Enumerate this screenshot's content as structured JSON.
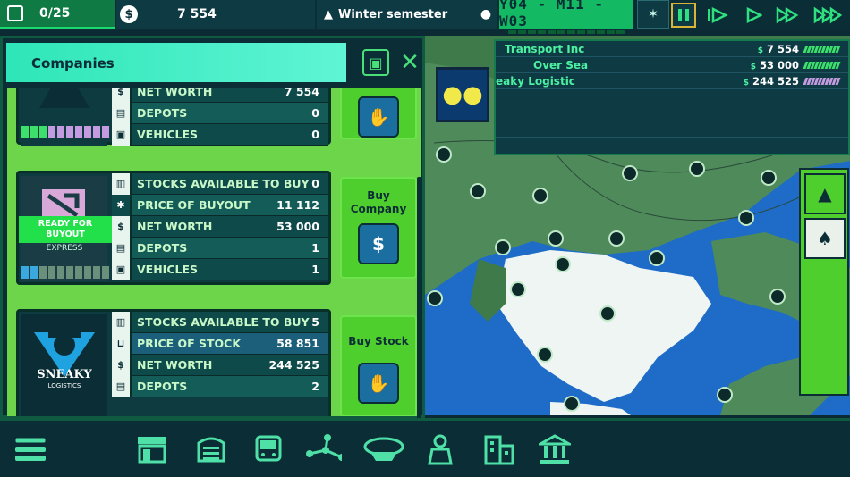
{
  "topbar": {
    "vehicles": "0/25",
    "money": "7 554",
    "semester": "Winter semester",
    "date": "Y04 - M11 - W03"
  },
  "panel": {
    "title": "Companies"
  },
  "cards": [
    {
      "rows": [
        {
          "label": "NET WORTH",
          "value": "7 554"
        },
        {
          "label": "DEPOTS",
          "value": "0"
        },
        {
          "label": "VEHICLES",
          "value": "0"
        }
      ]
    },
    {
      "badge": "READY FOR BUYOUT",
      "logo_text": "EXPRESS",
      "action": "Buy Company",
      "rows": [
        {
          "label": "STOCKS AVAILABLE TO BUY",
          "value": "0"
        },
        {
          "label": "PRICE OF BUYOUT",
          "value": "11 112"
        },
        {
          "label": "NET WORTH",
          "value": "53 000"
        },
        {
          "label": "DEPOTS",
          "value": "1"
        },
        {
          "label": "VEHICLES",
          "value": "1"
        }
      ]
    },
    {
      "logo_text": "SNEAKY",
      "logo_sub": "LOGISTICS",
      "action": "Buy Stock",
      "rows": [
        {
          "label": "STOCKS AVAILABLE TO BUY",
          "value": "5"
        },
        {
          "label": "PRICE OF STOCK",
          "value": "58 851"
        },
        {
          "label": "NET WORTH",
          "value": "244 525"
        },
        {
          "label": "DEPOTS",
          "value": "2"
        }
      ]
    }
  ],
  "ranking": [
    {
      "name": "Transport Inc",
      "currency": "$",
      "value": "7 554",
      "color": "#3ce06b"
    },
    {
      "name": "Over Sea",
      "currency": "$",
      "value": "53 000",
      "color": "#3ce06b"
    },
    {
      "name": "eaky Logistic",
      "currency": "$",
      "value": "244 525",
      "color": "#c49be0"
    }
  ],
  "icons": {
    "bottom": [
      "menu-icon",
      "shop-icon",
      "depot-icon",
      "bus-icon",
      "route-icon",
      "driver-cap-icon",
      "staff-icon",
      "city-icon",
      "bank-icon"
    ]
  }
}
